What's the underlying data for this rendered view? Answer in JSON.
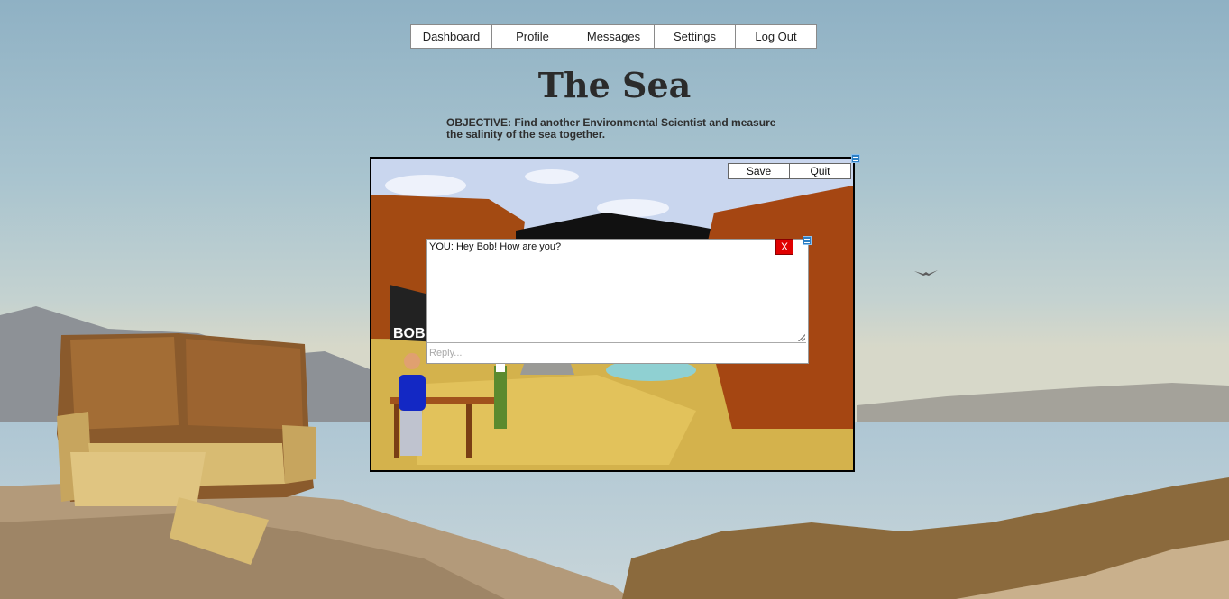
{
  "nav": {
    "items": [
      "Dashboard",
      "Profile",
      "Messages",
      "Settings",
      "Log Out"
    ]
  },
  "page": {
    "title": "The Sea",
    "objective": "OBJECTIVE: Find another Environmental Scientist and measure the salinity of the sea together."
  },
  "game": {
    "save_label": "Save",
    "quit_label": "Quit",
    "npc_name": "BOB",
    "menu_icon": "menu-icon"
  },
  "dialog": {
    "message": "YOU: Hey Bob! How are you?",
    "close_label": "X",
    "reply_placeholder": "Reply..."
  },
  "colors": {
    "close_button": "#e00000",
    "menu_icon": "#2d7fc4"
  }
}
